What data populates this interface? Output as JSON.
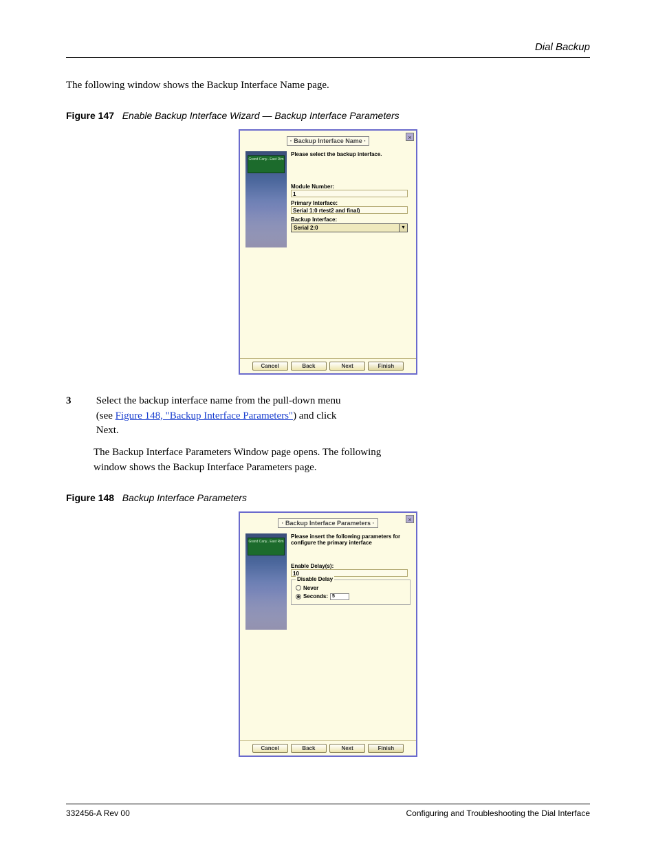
{
  "header": {
    "running": "Dial Backup"
  },
  "intro": {
    "p1": "The following window shows the Backup Interface Name page."
  },
  "figure1": {
    "label": "Figure 147",
    "title": "Enable Backup Interface Wizard — Backup Interface Parameters"
  },
  "wizard1": {
    "title": "· Backup Interface Name ·",
    "close": "×",
    "instruction": "Please select the backup interface.",
    "module_label": "Module Number:",
    "module_value": "1",
    "primary_label": "Primary Interface:",
    "primary_value": "Serial 1:0 rtest2 and final)",
    "backup_label": "Backup Interface:",
    "backup_value": "Serial 2:0",
    "arrow": "▾",
    "btn_cancel": "Cancel",
    "btn_back": "Back",
    "btn_next": "Next",
    "btn_finish": "Finish",
    "sign_text": "Grand Cany..\nEast Rim"
  },
  "step": {
    "num": "3",
    "p1_a": "Select the backup interface name from the pull-down menu (see ",
    "p1_link": "Figure 148, \"Backup Interface Parameters\"",
    "p1_b": ") and click Next.",
    "p2": "The Backup Interface Parameters Window page opens. The following window shows the Backup Interface Parameters page."
  },
  "figure2": {
    "label": "Figure 148",
    "title": "Backup Interface Parameters"
  },
  "wizard2": {
    "title": "· Backup Interface Parameters ·",
    "close": "×",
    "instruction": "Please insert the following parameters for configure the primary interface",
    "enable_label": "Enable Delay(s):",
    "enable_value": "10",
    "group_title": "Disable Delay",
    "radio_never": "Never",
    "radio_seconds": "Seconds:",
    "seconds_value": "5",
    "btn_cancel": "Cancel",
    "btn_back": "Back",
    "btn_next": "Next",
    "btn_finish": "Finish",
    "sign_text": "Grand Cany..\nEast Rim"
  },
  "footer": {
    "left": "332456-A Rev 00",
    "right": "Configuring and Troubleshooting the Dial Interface"
  }
}
